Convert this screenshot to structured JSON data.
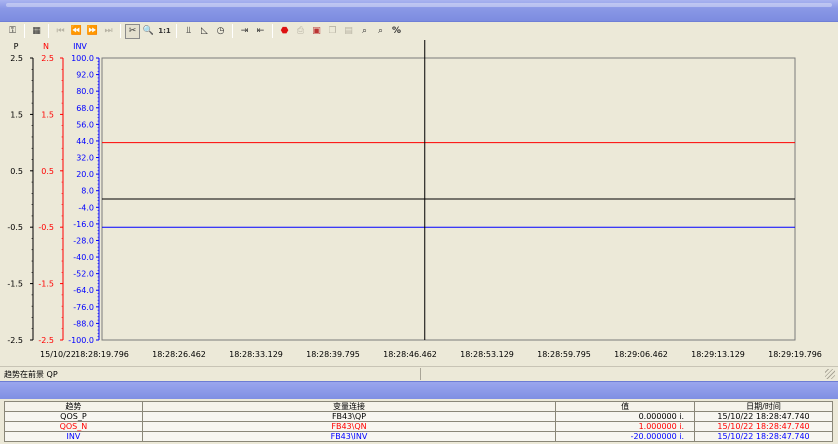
{
  "toolbar": {
    "icons": [
      "key-icon",
      "table-icon",
      "first-icon",
      "rewind-icon",
      "forward-icon",
      "last-icon",
      "cursor-select-icon",
      "zoom-icon",
      "one-to-one-icon",
      "axis-icon",
      "scale-icon",
      "clock-icon",
      "export-icon",
      "import-icon",
      "stop-icon",
      "print-preview-icon",
      "save-image-icon",
      "copy-icon",
      "save-icon",
      "search-icon",
      "find-icon",
      "percent-icon"
    ],
    "zoom_label": "1:1",
    "percent_label": "%"
  },
  "chart_data": {
    "type": "line",
    "axes": [
      {
        "name": "P",
        "color": "#000000",
        "min": -2.5,
        "max": 2.5,
        "tick_labels": [
          "2.5",
          "1.5",
          "0.5",
          "-0.5",
          "-1.5",
          "-2.5"
        ]
      },
      {
        "name": "N",
        "color": "#ff0000",
        "min": -2.5,
        "max": 2.5,
        "tick_labels": [
          "2.5",
          "1.5",
          "0.5",
          "-0.5",
          "-1.5",
          "-2.5"
        ]
      },
      {
        "name": "INV",
        "color": "#0000ff",
        "min": -100.0,
        "max": 100.0,
        "tick_labels": [
          "100.0",
          "92.0",
          "80.0",
          "68.0",
          "56.0",
          "44.0",
          "32.0",
          "20.0",
          "8.0",
          "-4.0",
          "-16.0",
          "-28.0",
          "-40.0",
          "-52.0",
          "-64.0",
          "-76.0",
          "-88.0",
          "-100.0"
        ]
      }
    ],
    "x_tick_labels": [
      "18:28:19.796",
      "18:28:26.462",
      "18:28:33.129",
      "18:28:39.795",
      "18:28:46.462",
      "18:28:53.129",
      "18:28:59.795",
      "18:29:06.462",
      "18:29:13.129",
      "18:29:19.796"
    ],
    "date_label": "15/10/22",
    "cursor_time": "18:28:47.740",
    "series": [
      {
        "name": "QOS_P",
        "axis": "P",
        "color": "#000000",
        "value": 0.0
      },
      {
        "name": "QOS_N",
        "axis": "N",
        "color": "#ff0000",
        "value": 1.0
      },
      {
        "name": "INV",
        "axis": "INV",
        "color": "#0000ff",
        "value": -20.0
      }
    ]
  },
  "status": {
    "text": "趋势在前景 QP"
  },
  "table": {
    "headers": [
      "趋势",
      "变量连接",
      "值",
      "日期/时间"
    ],
    "rows": [
      {
        "trend": "QOS_P",
        "link": "FB43\\QP",
        "value": "0.000000 i.",
        "datetime": "15/10/22 18:28:47.740",
        "color": "#000000"
      },
      {
        "trend": "QOS_N",
        "link": "FB43\\QN",
        "value": "1.000000 i.",
        "datetime": "15/10/22 18:28:47.740",
        "color": "#ff0000"
      },
      {
        "trend": "INV",
        "link": "FB43\\INV",
        "value": "-20.000000 i.",
        "datetime": "15/10/22 18:28:47.740",
        "color": "#0000ff"
      }
    ]
  }
}
